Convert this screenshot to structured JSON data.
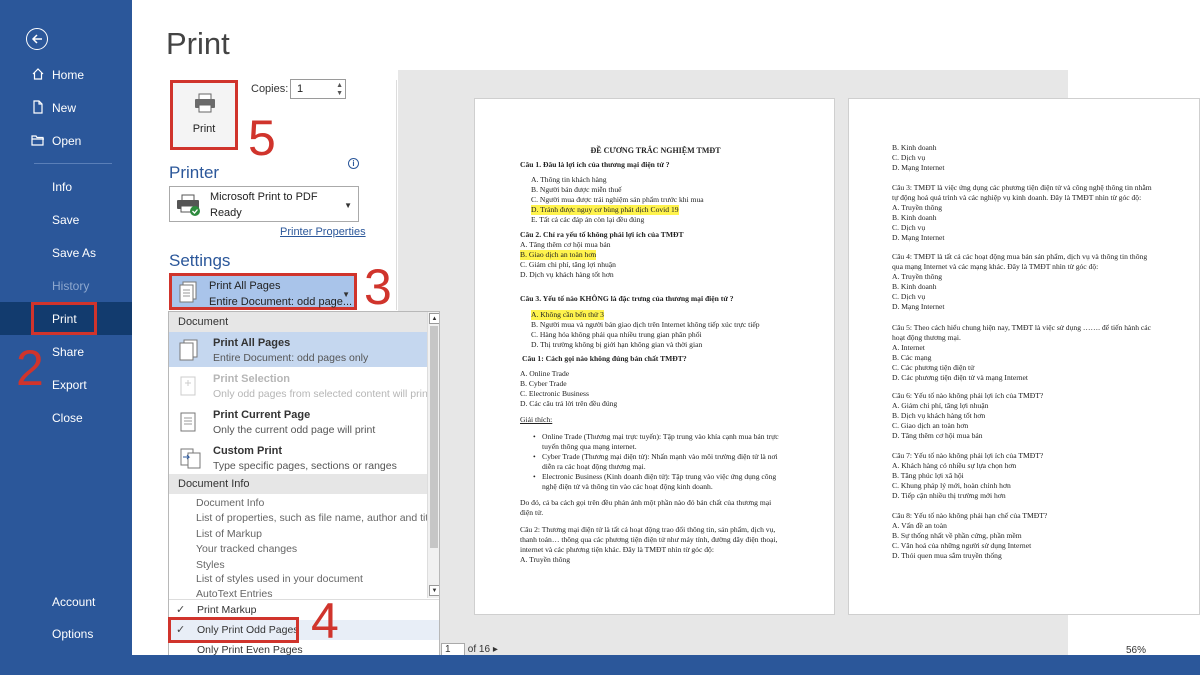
{
  "sidebar": {
    "items": [
      {
        "label": "Home",
        "icon": "home-icon"
      },
      {
        "label": "New",
        "icon": "new-document-icon"
      },
      {
        "label": "Open",
        "icon": "folder-open-icon"
      },
      {
        "label": "Info"
      },
      {
        "label": "Save"
      },
      {
        "label": "Save As"
      },
      {
        "label": "History",
        "disabled": true
      },
      {
        "label": "Print",
        "active": true
      },
      {
        "label": "Share"
      },
      {
        "label": "Export"
      },
      {
        "label": "Close"
      },
      {
        "label": "Account"
      },
      {
        "label": "Options"
      }
    ]
  },
  "print": {
    "title": "Print",
    "button_label": "Print",
    "copies_label": "Copies:",
    "copies_value": "1"
  },
  "printer": {
    "heading": "Printer",
    "name": "Microsoft Print to PDF",
    "status": "Ready",
    "properties_link": "Printer Properties"
  },
  "settings": {
    "heading": "Settings",
    "selected_title": "Print All Pages",
    "selected_sub": "Entire Document: odd page..."
  },
  "dropdown": {
    "document_header": "Document",
    "document_items": [
      {
        "title": "Print All Pages",
        "sub": "Entire Document: odd pages only",
        "selected": true
      },
      {
        "title": "Print Selection",
        "sub": "Only odd pages from selected content will print",
        "disabled": true
      },
      {
        "title": "Print Current Page",
        "sub": "Only the current odd page will print"
      },
      {
        "title": "Custom Print",
        "sub": "Type specific pages, sections or ranges"
      }
    ],
    "info_header": "Document Info",
    "info_items": [
      "Document Info",
      "List of properties, such as file name, author and title",
      "List of Markup",
      "Your tracked changes",
      "Styles",
      "List of styles used in your document",
      "AutoText Entries"
    ],
    "checks": [
      {
        "label": "Print Markup",
        "checked": true
      },
      {
        "label": "Only Print Odd Pages",
        "checked": true
      },
      {
        "label": "Only Print Even Pages",
        "checked": false
      }
    ]
  },
  "steps": {
    "two": "2",
    "three": "3",
    "four": "4",
    "five": "5"
  },
  "pager": {
    "current": "1",
    "total": "of 16"
  },
  "zoom": "56%",
  "preview": {
    "page1": {
      "title": "ĐỀ CƯƠNG TRẮC NGHIỆM TMĐT",
      "lines": [
        "Câu 1. Đâu là lợi ích của thương mại điện tử ?",
        "A.   Thông tin khách hàng",
        "B.   Người bán được miễn thuế",
        "C.   Người mua được trải nghiệm sản phẩm trước khi mua",
        "D.   Tránh được nguy cơ bùng phát dịch Covid 19",
        "E.   Tất cả các đáp án còn lại đều đúng",
        "Câu 2. Chỉ ra yếu tố không phải lợi ích của TMĐT",
        "A. Tăng thêm cơ hội mua bán",
        "B. Giao dịch an toàn hơn",
        "C. Giảm chi phí, tăng lợi nhuận",
        "D. Dịch vụ khách hàng tốt hơn",
        "Câu 3. Yếu tố nào KHÔNG là đặc trưng của thương mại điện tử ?",
        "A.   Không cần bến thử 3",
        "B.   Người mua và người bán giao dịch trên Internet không tiếp xúc trực tiếp",
        "C.   Hàng hóa không phải qua nhiều trung gian phân phối",
        "D.   Thị trường không bị giới hạn không gian và thời gian",
        "Câu 1: Cách gọi nào không đúng bản chất TMĐT?",
        "A. Online Trade",
        "B. Cyber Trade",
        "C. Electronic Business",
        "D. Các câu trả lời trên đều đúng",
        "Giải thích:",
        "Online Trade (Thương mại trực tuyến): Tập trung vào khía cạnh mua bán trực",
        "tuyến thông qua mạng internet.",
        "Cyber Trade (Thương mại điện tử): Nhấn mạnh vào môi trường điện tử là nơi",
        "diễn ra các hoạt động thương mại.",
        "Electronic Business (Kinh doanh điện tử): Tập trung vào việc ứng dụng công",
        "nghệ điện tử và thông tin vào các hoạt động kinh doanh.",
        "Do đó, cả ba cách gọi trên đều phản ánh một phần nào đó bản chất của thương mại",
        "điện tử.",
        "Câu 2: Thương mại điện tử là tất cả hoạt động trao đổi thông tin, sản phẩm, dịch vụ,",
        "thanh toán… thông qua các phương tiện điện tử như máy tính, đường dây điện thoại,",
        "internet và các phương tiện khác. Đây là TMĐT nhìn từ góc độ:",
        "A. Truyền thông"
      ]
    },
    "page2": {
      "lines": [
        "B. Kinh doanh",
        "C. Dịch vụ",
        "D. Mạng Internet",
        "Câu 3: TMĐT là việc ứng dụng các phương tiện điện tử và công nghệ thông tin nhằm",
        "tự động hoá quá trình và các nghiệp vụ kinh doanh. Đây là TMĐT nhìn từ góc độ:",
        "A. Truyền thông",
        "B. Kinh doanh",
        "C. Dịch vụ",
        "D. Mạng Internet",
        "Câu 4: TMĐT là tất cả các hoạt động mua bán sản phẩm, dịch vụ và thông tin thông",
        "qua mạng Internet và các mạng khác. Đây là TMĐT nhìn từ góc độ:",
        "A. Truyền thông",
        "B. Kinh doanh",
        "C. Dịch vụ",
        "D. Mạng Internet",
        "Câu 5: Theo cách hiểu chung hiện nay, TMĐT là việc sử dụng ……. để tiến hành các",
        "hoạt động thương mại.",
        "A. Internet",
        "B. Các mạng",
        "C. Các phương tiện điện tử",
        "D. Các phương tiện điện tử và mạng Internet",
        "Câu 6: Yếu tố nào không phải lợi ích của TMĐT?",
        "A. Giảm chi phí, tăng lợi nhuận",
        "B. Dịch vụ khách hàng tốt hơn",
        "C. Giao dịch an toàn hơn",
        "D. Tăng thêm cơ hội mua bán",
        "Câu 7: Yếu tố nào không phải lợi ích của TMĐT?",
        "A. Khách hàng có nhiều sự lựa chọn hơn",
        "B. Tăng phúc lợi xã hội",
        "C. Khung pháp lý mới, hoàn chỉnh hơn",
        "D. Tiếp cận nhiều thị trường mới hơn",
        "Câu 8: Yếu tố nào không phải hạn chế của TMĐT?",
        "A. Vấn đề an toàn",
        "B. Sự thống nhất về phần cứng, phần mềm",
        "C. Văn hoá của những người sử dụng Internet",
        "D. Thói quen mua sắm truyền thống"
      ]
    }
  }
}
